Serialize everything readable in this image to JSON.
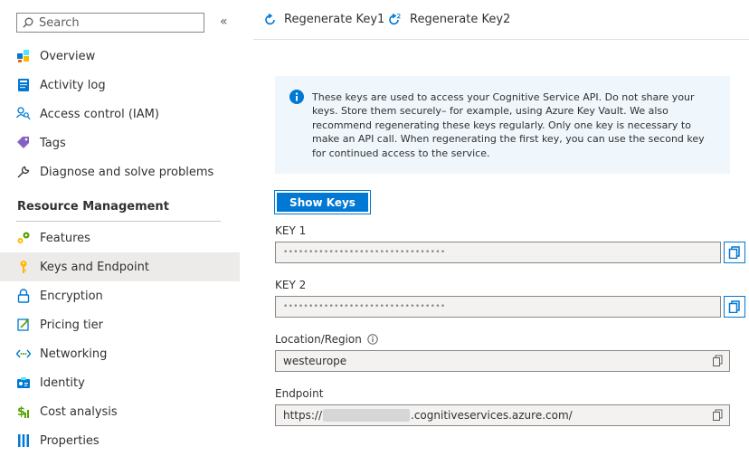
{
  "sidebar": {
    "search_placeholder": "Search",
    "collapse_glyph": "«",
    "items_top": [
      {
        "label": "Overview",
        "icon": "overview-icon"
      },
      {
        "label": "Activity log",
        "icon": "activity-log-icon"
      },
      {
        "label": "Access control (IAM)",
        "icon": "access-control-icon"
      },
      {
        "label": "Tags",
        "icon": "tag-icon"
      },
      {
        "label": "Diagnose and solve problems",
        "icon": "wrench-icon"
      }
    ],
    "section_title": "Resource Management",
    "items_rm": [
      {
        "label": "Features",
        "icon": "gears-icon"
      },
      {
        "label": "Keys and Endpoint",
        "icon": "key-icon",
        "active": true
      },
      {
        "label": "Encryption",
        "icon": "lock-icon"
      },
      {
        "label": "Pricing tier",
        "icon": "pricing-icon"
      },
      {
        "label": "Networking",
        "icon": "networking-icon"
      },
      {
        "label": "Identity",
        "icon": "identity-icon"
      },
      {
        "label": "Cost analysis",
        "icon": "cost-icon"
      },
      {
        "label": "Properties",
        "icon": "properties-icon"
      }
    ]
  },
  "toolbar": {
    "regen1_label": "Regenerate Key1",
    "regen2_label": "Regenerate Key2"
  },
  "info": {
    "text": "These keys are used to access your Cognitive Service API. Do not share your keys. Store them securely– for example, using Azure Key Vault. We also recommend regenerating these keys regularly. Only one key is necessary to make an API call. When regenerating the first key, you can use the second key for continued access to the service."
  },
  "show_keys_label": "Show Keys",
  "fields": {
    "key1_label": "KEY 1",
    "key1_value": "••••••••••••••••••••••••••••••••",
    "key2_label": "KEY 2",
    "key2_value": "••••••••••••••••••••••••••••••••",
    "location_label": "Location/Region",
    "location_value": "westeurope",
    "endpoint_label": "Endpoint",
    "endpoint_prefix": "https://",
    "endpoint_suffix": ".cognitiveservices.azure.com/"
  },
  "colors": {
    "accent": "#0078d4",
    "info_bg": "#eff6fc",
    "active_row": "#edebe9"
  }
}
